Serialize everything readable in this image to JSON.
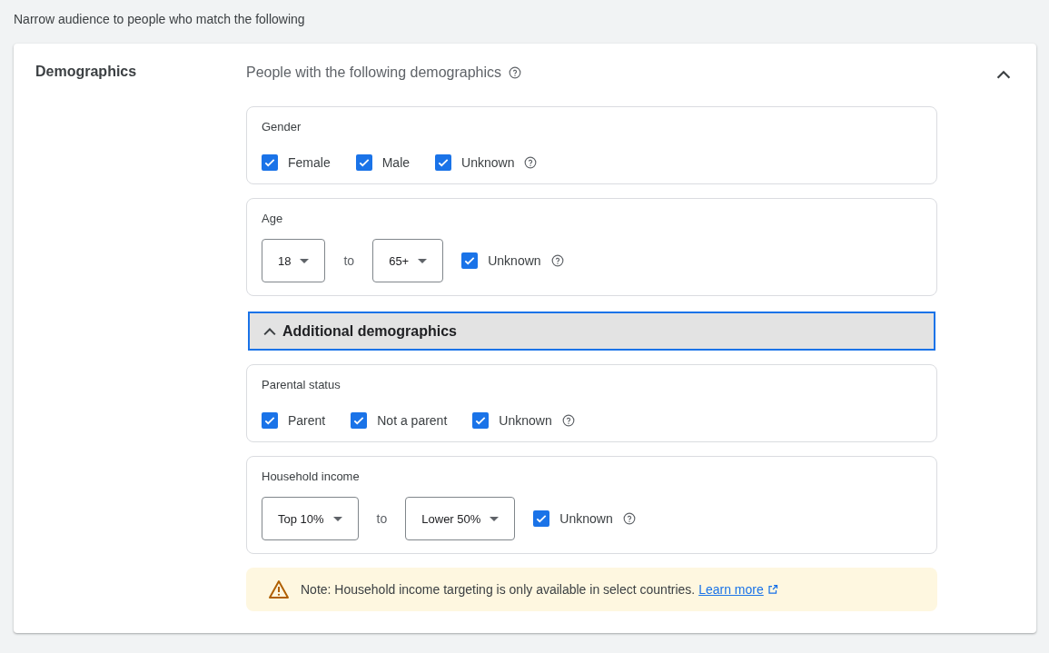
{
  "intro": "Narrow audience to people who match the following",
  "panel": {
    "title": "Demographics",
    "subtitle": "People with the following demographics",
    "expanded": true
  },
  "sections": [
    {
      "kind": "checkboxes",
      "title": "Gender",
      "options": [
        {
          "label": "Female",
          "checked": true,
          "help": false
        },
        {
          "label": "Male",
          "checked": true,
          "help": false
        },
        {
          "label": "Unknown",
          "checked": true,
          "help": true
        }
      ]
    },
    {
      "kind": "range",
      "title": "Age",
      "from": "18",
      "separator": "to",
      "to": "65+",
      "unknown": {
        "label": "Unknown",
        "checked": true,
        "help": true
      }
    }
  ],
  "additional": {
    "label": "Additional demographics",
    "expanded": true,
    "focused": true
  },
  "additional_sections": [
    {
      "kind": "checkboxes",
      "title": "Parental status",
      "options": [
        {
          "label": "Parent",
          "checked": true,
          "help": false
        },
        {
          "label": "Not a parent",
          "checked": true,
          "help": false
        },
        {
          "label": "Unknown",
          "checked": true,
          "help": true
        }
      ]
    },
    {
      "kind": "range",
      "title": "Household income",
      "from": "Top 10%",
      "separator": "to",
      "to": "Lower 50%",
      "unknown": {
        "label": "Unknown",
        "checked": true,
        "help": true
      }
    }
  ],
  "note": {
    "text": "Note: Household income targeting is only available in select countries.",
    "link": "Learn more"
  }
}
